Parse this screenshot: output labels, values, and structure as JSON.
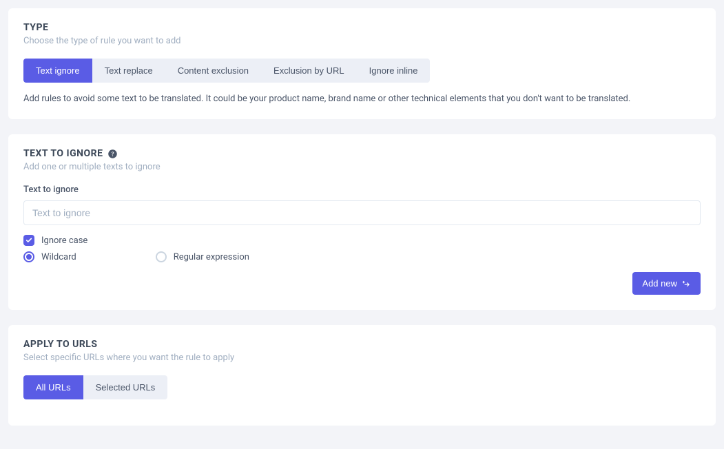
{
  "type_section": {
    "title": "TYPE",
    "subtitle": "Choose the type of rule you want to add",
    "tabs": [
      {
        "label": "Text ignore"
      },
      {
        "label": "Text replace"
      },
      {
        "label": "Content exclusion"
      },
      {
        "label": "Exclusion by URL"
      },
      {
        "label": "Ignore inline"
      }
    ],
    "description": "Add rules to avoid some text to be translated. It could be your product name, brand name or other technical elements that you don't want to be translated."
  },
  "ignore_section": {
    "title": "TEXT TO IGNORE",
    "subtitle": "Add one or multiple texts to ignore",
    "field_label": "Text to ignore",
    "placeholder": "Text to ignore",
    "checkbox_label": "Ignore case",
    "radio_options": [
      {
        "label": "Wildcard"
      },
      {
        "label": "Regular expression"
      }
    ],
    "add_button": "Add new"
  },
  "urls_section": {
    "title": "APPLY TO URLS",
    "subtitle": "Select specific URLs where you want the rule to apply",
    "tabs": [
      {
        "label": "All URLs"
      },
      {
        "label": "Selected URLs"
      }
    ]
  }
}
